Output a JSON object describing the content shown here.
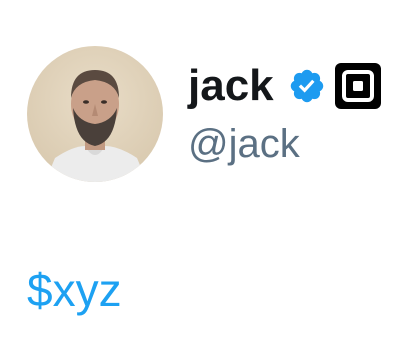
{
  "profile": {
    "display_name": "jack",
    "handle": "@jack",
    "verified": true,
    "affiliate_badge_icon": "square-logo-icon"
  },
  "tweet": {
    "text": "$xyz",
    "cashtag_color": "#1da1f2"
  },
  "colors": {
    "name": "#14171a",
    "handle": "#5b7083",
    "verified_badge": "#1d9bf0",
    "affiliate_badge": "#000000"
  }
}
